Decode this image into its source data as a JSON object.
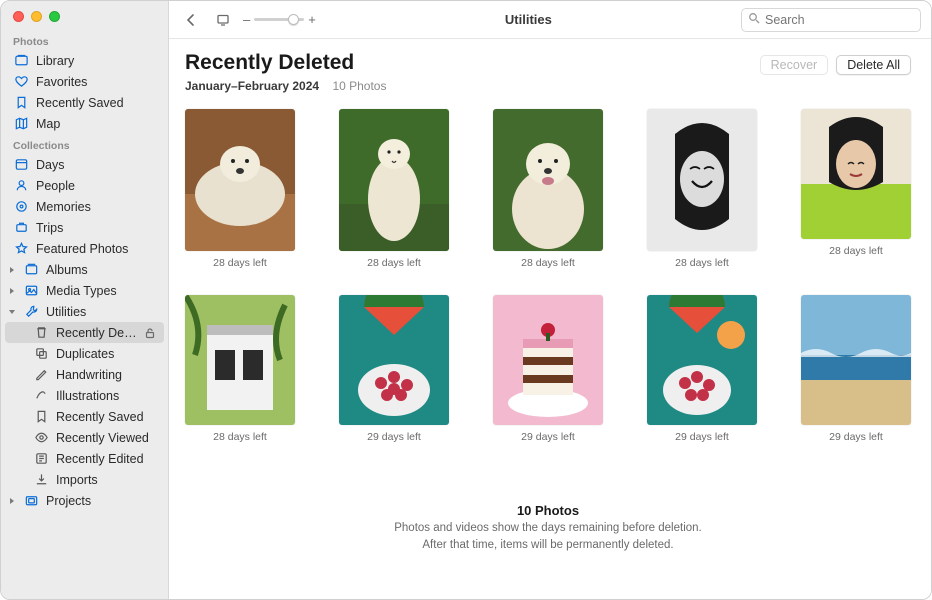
{
  "toolbar": {
    "title": "Utilities",
    "search_placeholder": "Search",
    "zoom_minus": "–",
    "zoom_plus": "+"
  },
  "page": {
    "title": "Recently Deleted",
    "date_range": "January–February 2024",
    "count_label": "10 Photos"
  },
  "actions": {
    "recover": "Recover",
    "delete_all": "Delete All"
  },
  "sidebar": {
    "sections": {
      "photos_label": "Photos",
      "collections_label": "Collections"
    },
    "photos": {
      "library": "Library",
      "favorites": "Favorites",
      "recently_saved": "Recently Saved",
      "map": "Map"
    },
    "collections": {
      "days": "Days",
      "people": "People",
      "memories": "Memories",
      "trips": "Trips",
      "featured": "Featured Photos",
      "albums": "Albums",
      "media_types": "Media Types",
      "utilities": "Utilities",
      "utilities_children": {
        "recently_deleted": "Recently Delet…",
        "duplicates": "Duplicates",
        "handwriting": "Handwriting",
        "illustrations": "Illustrations",
        "recently_saved": "Recently Saved",
        "recently_viewed": "Recently Viewed",
        "recently_edited": "Recently Edited",
        "imports": "Imports"
      },
      "projects": "Projects"
    }
  },
  "thumbnails": [
    {
      "caption": "28 days left",
      "kind": "dog-lying"
    },
    {
      "caption": "28 days left",
      "kind": "dog-standing"
    },
    {
      "caption": "28 days left",
      "kind": "dog-pup"
    },
    {
      "caption": "28 days left",
      "kind": "portrait-bw"
    },
    {
      "caption": "28 days left",
      "kind": "portrait-green"
    },
    {
      "caption": "28 days left",
      "kind": "house"
    },
    {
      "caption": "29 days left",
      "kind": "fruit-teal"
    },
    {
      "caption": "29 days left",
      "kind": "cake"
    },
    {
      "caption": "29 days left",
      "kind": "fruit-teal2"
    },
    {
      "caption": "29 days left",
      "kind": "beach"
    }
  ],
  "footer": {
    "title": "10 Photos",
    "line1": "Photos and videos show the days remaining before deletion.",
    "line2": "After that time, items will be permanently deleted."
  }
}
